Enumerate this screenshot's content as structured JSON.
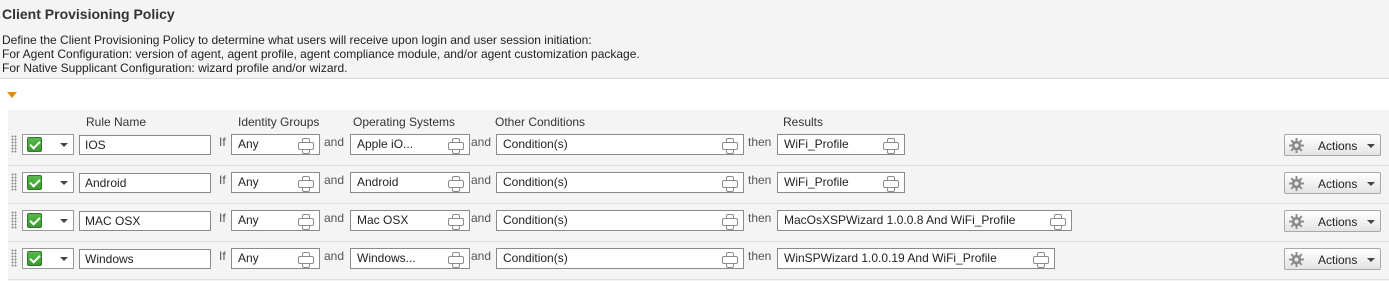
{
  "page": {
    "title": "Client Provisioning Policy",
    "description": [
      "Define the Client Provisioning Policy to determine what users will receive upon login and user session initiation:",
      "For Agent Configuration: version of agent, agent profile, agent compliance module, and/or agent customization package.",
      "For Native Supplicant Configuration: wizard profile and/or wizard."
    ]
  },
  "columns": {
    "rule_name": "Rule Name",
    "identity_groups": "Identity Groups",
    "operating_systems": "Operating Systems",
    "other_conditions": "Other Conditions",
    "results": "Results"
  },
  "connectors": {
    "if": "If",
    "and": "and",
    "then": "then"
  },
  "actions_label": "Actions",
  "rules": [
    {
      "enabled": true,
      "name": "IOS",
      "identity_group": "Any",
      "operating_system": "Apple iO...",
      "other_conditions": "Condition(s)",
      "result": "WiFi_Profile"
    },
    {
      "enabled": true,
      "name": "Android",
      "identity_group": "Any",
      "operating_system": "Android",
      "other_conditions": "Condition(s)",
      "result": "WiFi_Profile"
    },
    {
      "enabled": true,
      "name": "MAC OSX",
      "identity_group": "Any",
      "operating_system": "Mac OSX",
      "other_conditions": "Condition(s)",
      "result": "MacOsXSPWizard 1.0.0.8 And WiFi_Profile"
    },
    {
      "enabled": true,
      "name": "Windows",
      "identity_group": "Any",
      "operating_system": "Windows...",
      "other_conditions": "Condition(s)",
      "result": "WinSPWizard 1.0.0.19 And WiFi_Profile"
    }
  ],
  "colors": {
    "accent": "#e8861f",
    "enabled_green": "#4aa83d"
  },
  "icons": [
    "drag-handle-icon",
    "checkbox-icon",
    "chevron-down-icon",
    "add-icon",
    "gear-icon"
  ]
}
